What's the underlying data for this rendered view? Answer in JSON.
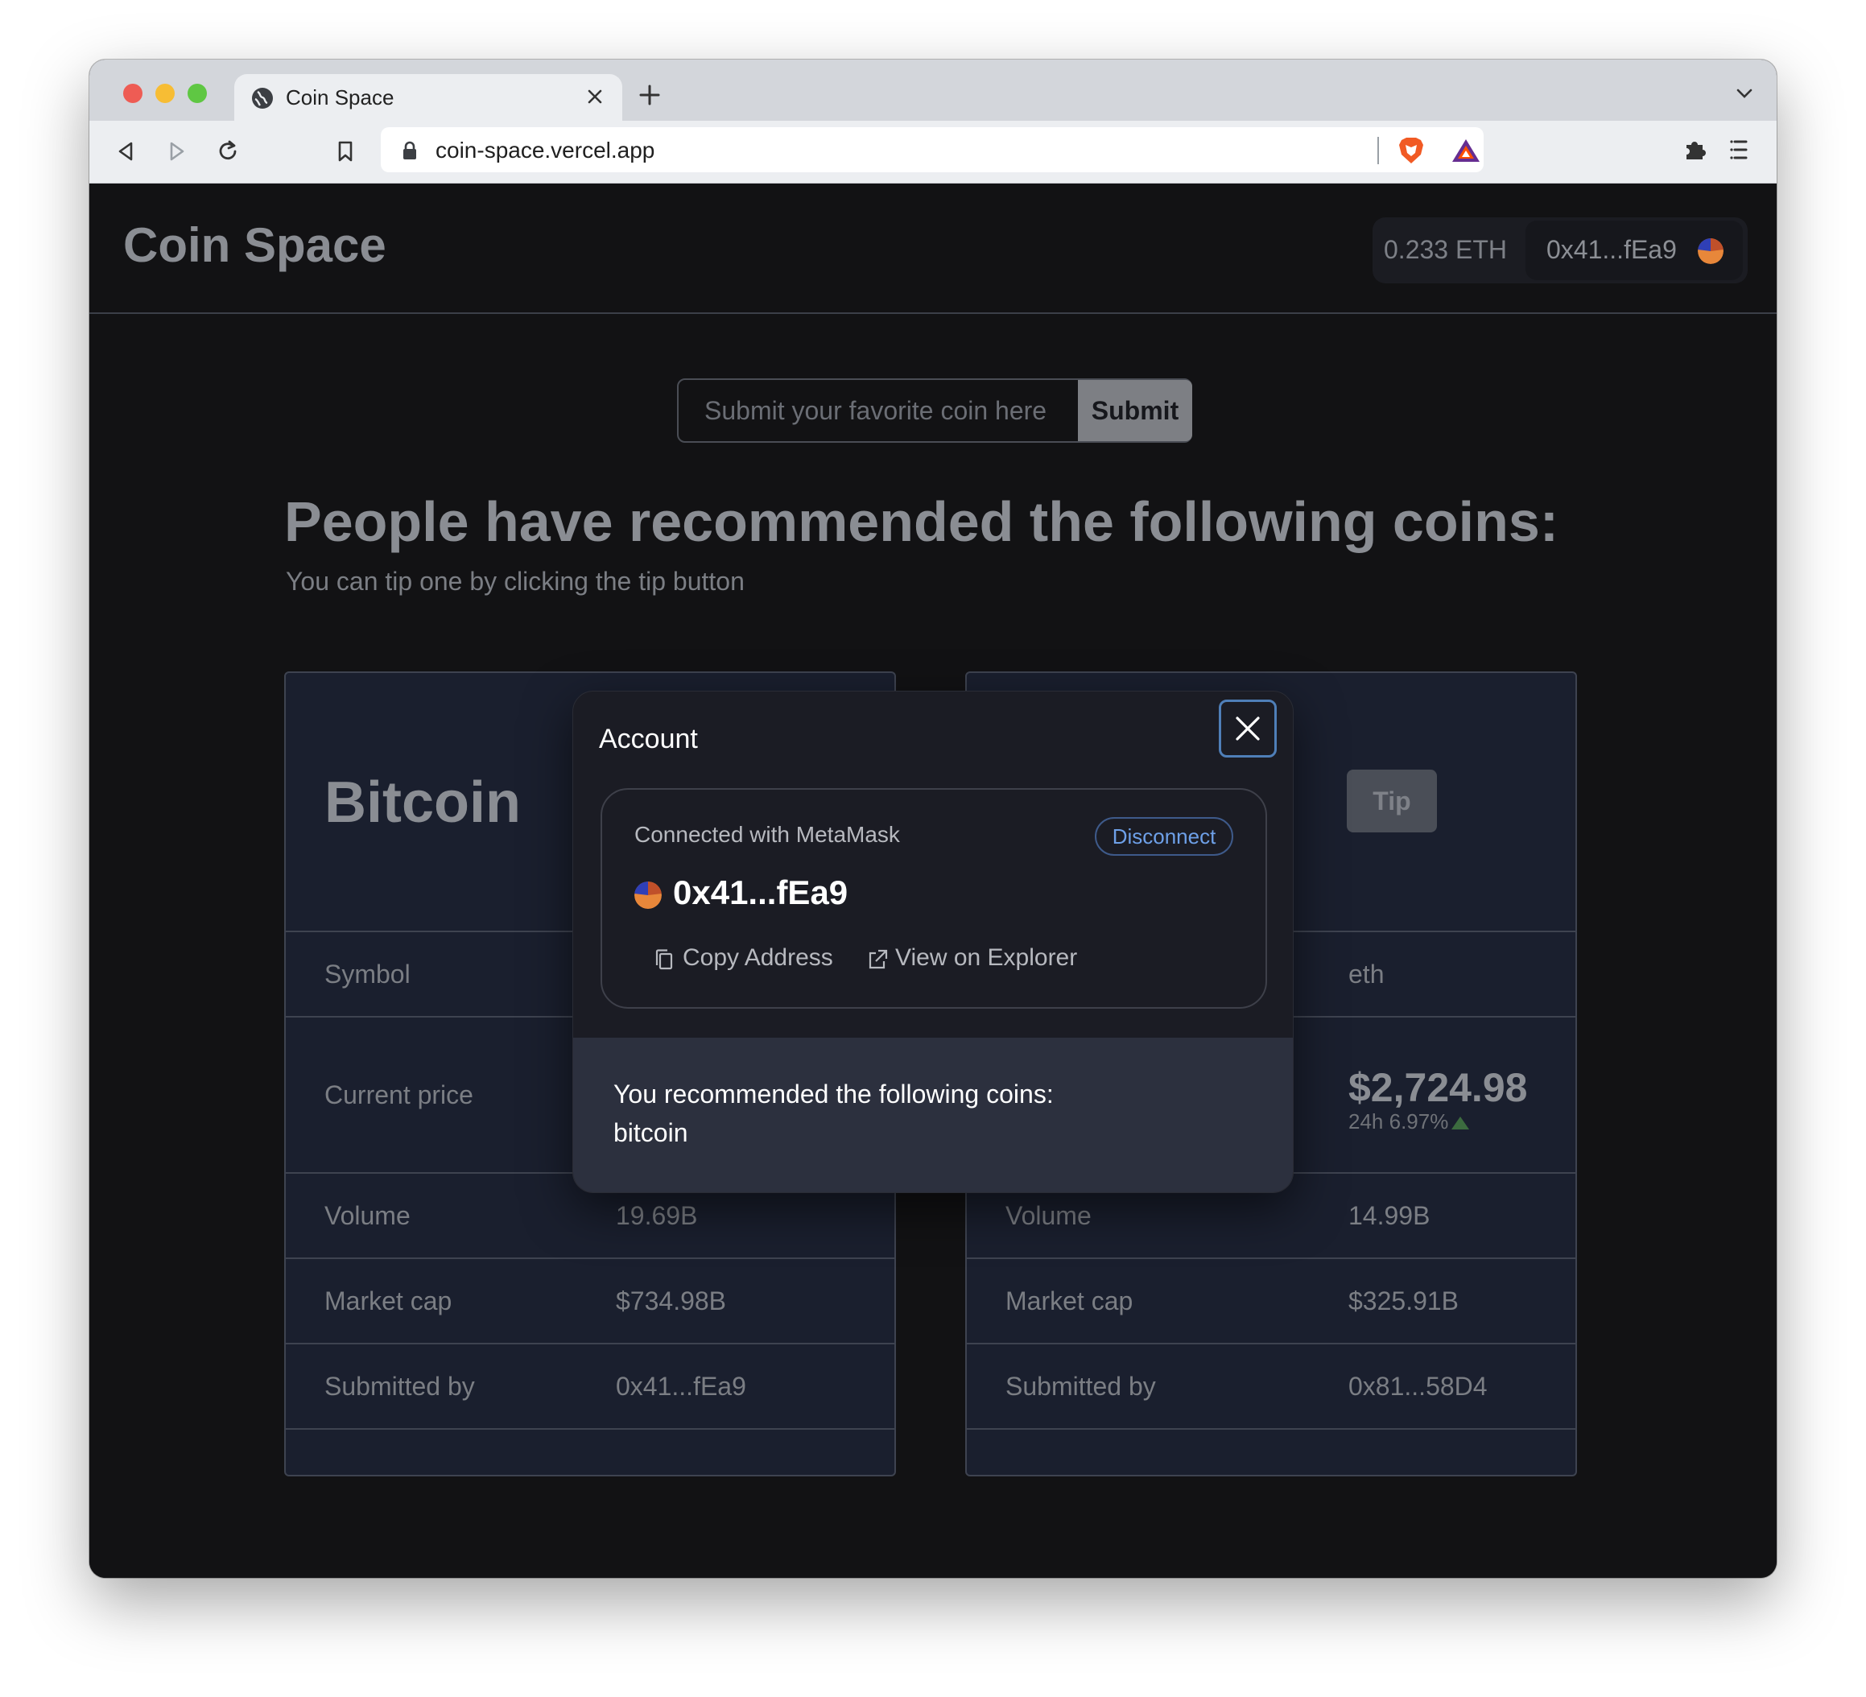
{
  "browser": {
    "tab_title": "Coin Space",
    "url": "coin-space.vercel.app"
  },
  "header": {
    "brand": "Coin Space",
    "balance": "0.233 ETH",
    "account_address": "0x41...fEa9"
  },
  "submit": {
    "placeholder": "Submit your favorite coin here",
    "button_label": "Submit"
  },
  "main": {
    "headline": "People have recommended the following coins:",
    "subline": "You can tip one by clicking the tip button"
  },
  "cards": [
    {
      "name": "Bitcoin",
      "rows": {
        "symbol_label": "Symbol",
        "current_price_label": "Current price",
        "volume_label": "Volume",
        "volume": "19.69B",
        "market_cap_label": "Market cap",
        "market_cap": "$734.98B",
        "submitted_by_label": "Submitted by",
        "submitted_by": "0x41...fEa9"
      }
    },
    {
      "tip_label": "Tip",
      "rows": {
        "symbol": "eth",
        "price": "$2,724.98",
        "change": "24h 6.97%",
        "volume_label": "Volume",
        "volume": "14.99B",
        "market_cap_label": "Market cap",
        "market_cap": "$325.91B",
        "submitted_by_label": "Submitted by",
        "submitted_by": "0x81...58D4"
      }
    }
  ],
  "modal": {
    "title": "Account",
    "connected_with": "Connected with MetaMask",
    "disconnect_label": "Disconnect",
    "address": "0x41...fEa9",
    "copy_label": "Copy Address",
    "explorer_label": "View on Explorer",
    "footer_line1": "You recommended the following coins:",
    "footer_line2": "bitcoin"
  },
  "colors": {
    "page_bg": "#121214",
    "card_bg": "#1a1f2e",
    "accent_link": "#6ea0e8",
    "avatar_orange": "#e8873a",
    "avatar_blue": "#2f3fb6"
  },
  "icons": [
    "globe-icon",
    "close-icon",
    "plus-icon",
    "chevron-down-icon",
    "back-icon",
    "forward-icon",
    "reload-icon",
    "bookmark-icon",
    "lock-icon",
    "brave-lion-icon",
    "bat-triangle-icon",
    "puzzle-icon",
    "menu-icon",
    "copy-icon",
    "external-link-icon"
  ]
}
